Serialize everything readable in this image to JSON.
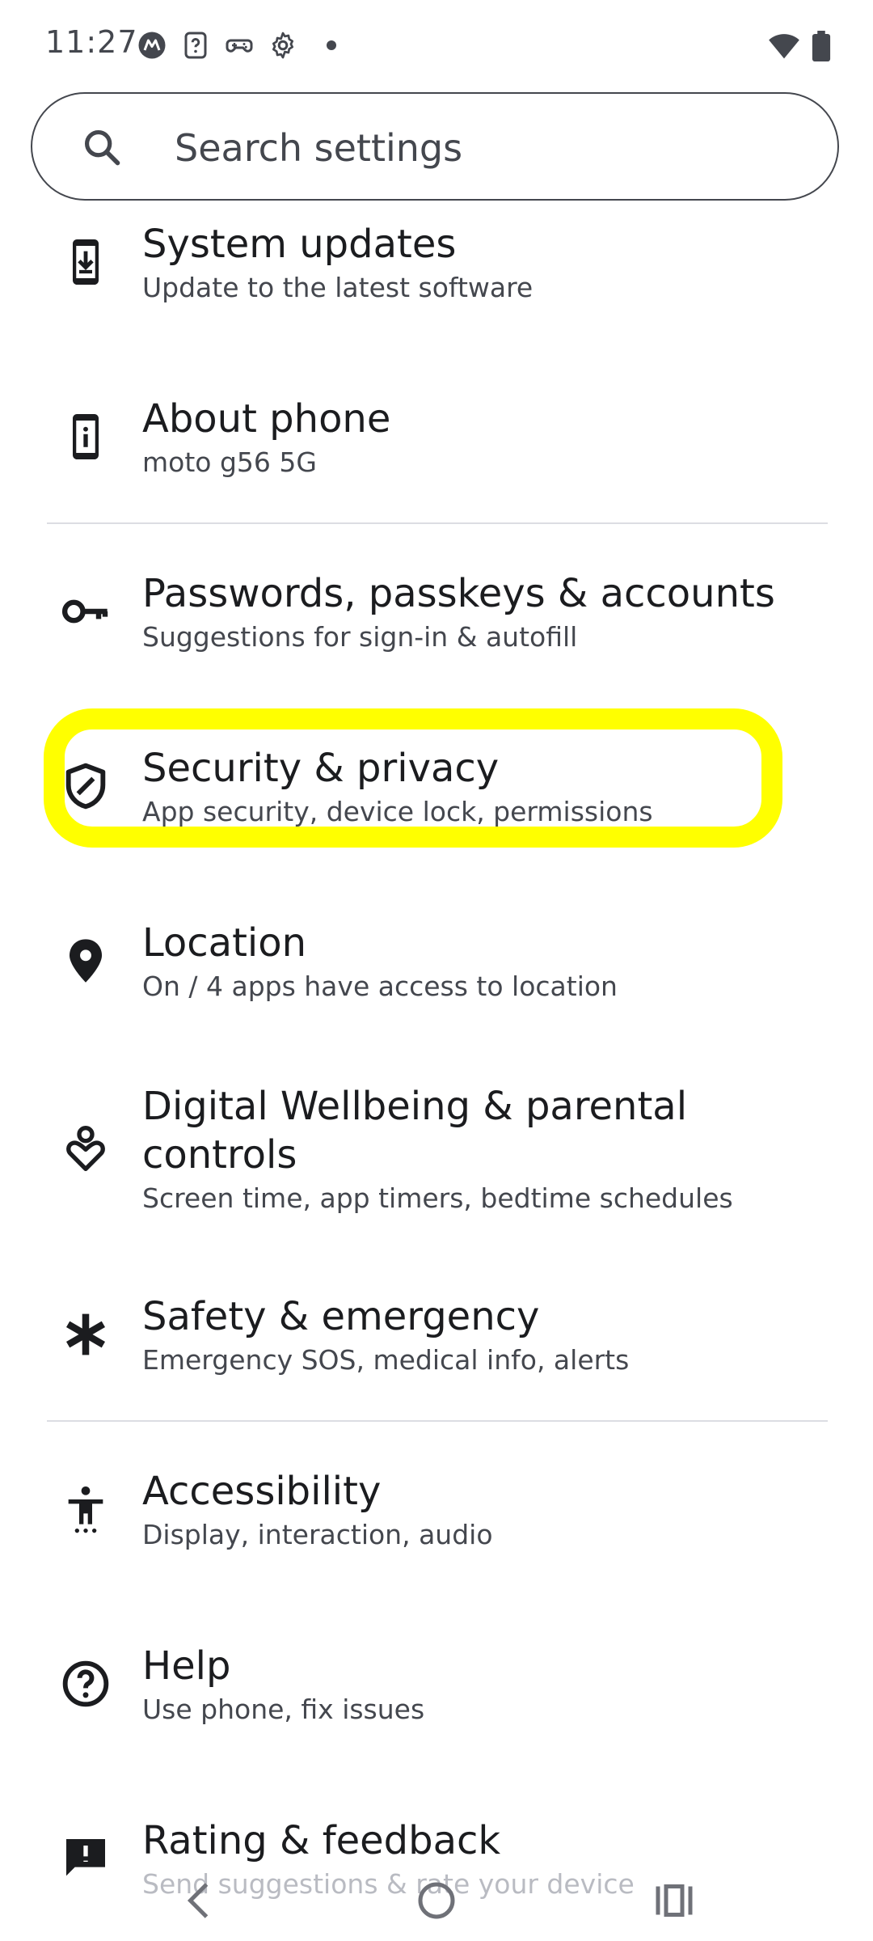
{
  "status_bar": {
    "time": "11:27",
    "icons": [
      "motorola-logo-icon",
      "unknown-app-icon",
      "gamepad-icon",
      "gear-icon",
      "notification-dot-icon",
      "wifi-icon",
      "battery-icon"
    ]
  },
  "search": {
    "placeholder": "Search settings"
  },
  "settings": {
    "items": [
      {
        "id": "system-updates",
        "title": "System updates",
        "summary": "Update to the latest software",
        "icon": "system-update-icon"
      },
      {
        "id": "about-phone",
        "title": "About phone",
        "summary": "moto g56 5G",
        "icon": "info-icon"
      },
      {
        "id": "passwords",
        "title": "Passwords, passkeys & accounts",
        "summary": "Suggestions for sign-in & autofill",
        "icon": "key-icon"
      },
      {
        "id": "security-privacy",
        "title": "Security & privacy",
        "summary": "App security, device lock, permissions",
        "icon": "shield-icon"
      },
      {
        "id": "location",
        "title": "Location",
        "summary": "On / 4 apps have access to location",
        "icon": "location-pin-icon"
      },
      {
        "id": "digital-wellbeing",
        "title": "Digital Wellbeing & parental controls",
        "summary": "Screen time, app timers, bedtime schedules",
        "icon": "wellbeing-icon"
      },
      {
        "id": "safety-emergency",
        "title": "Safety & emergency",
        "summary": "Emergency SOS, medical info, alerts",
        "icon": "asterisk-icon"
      },
      {
        "id": "accessibility",
        "title": "Accessibility",
        "summary": "Display, interaction, audio",
        "icon": "accessibility-icon"
      },
      {
        "id": "help",
        "title": "Help",
        "summary": "Use phone, fix issues",
        "icon": "help-icon"
      },
      {
        "id": "rating-feedback",
        "title": "Rating & feedback",
        "summary": "Send suggestions & rate your device",
        "icon": "feedback-icon"
      }
    ]
  },
  "highlight_color": "#ffff00",
  "nav_bar": {
    "icons": [
      "back-icon",
      "home-icon",
      "recents-icon"
    ]
  }
}
